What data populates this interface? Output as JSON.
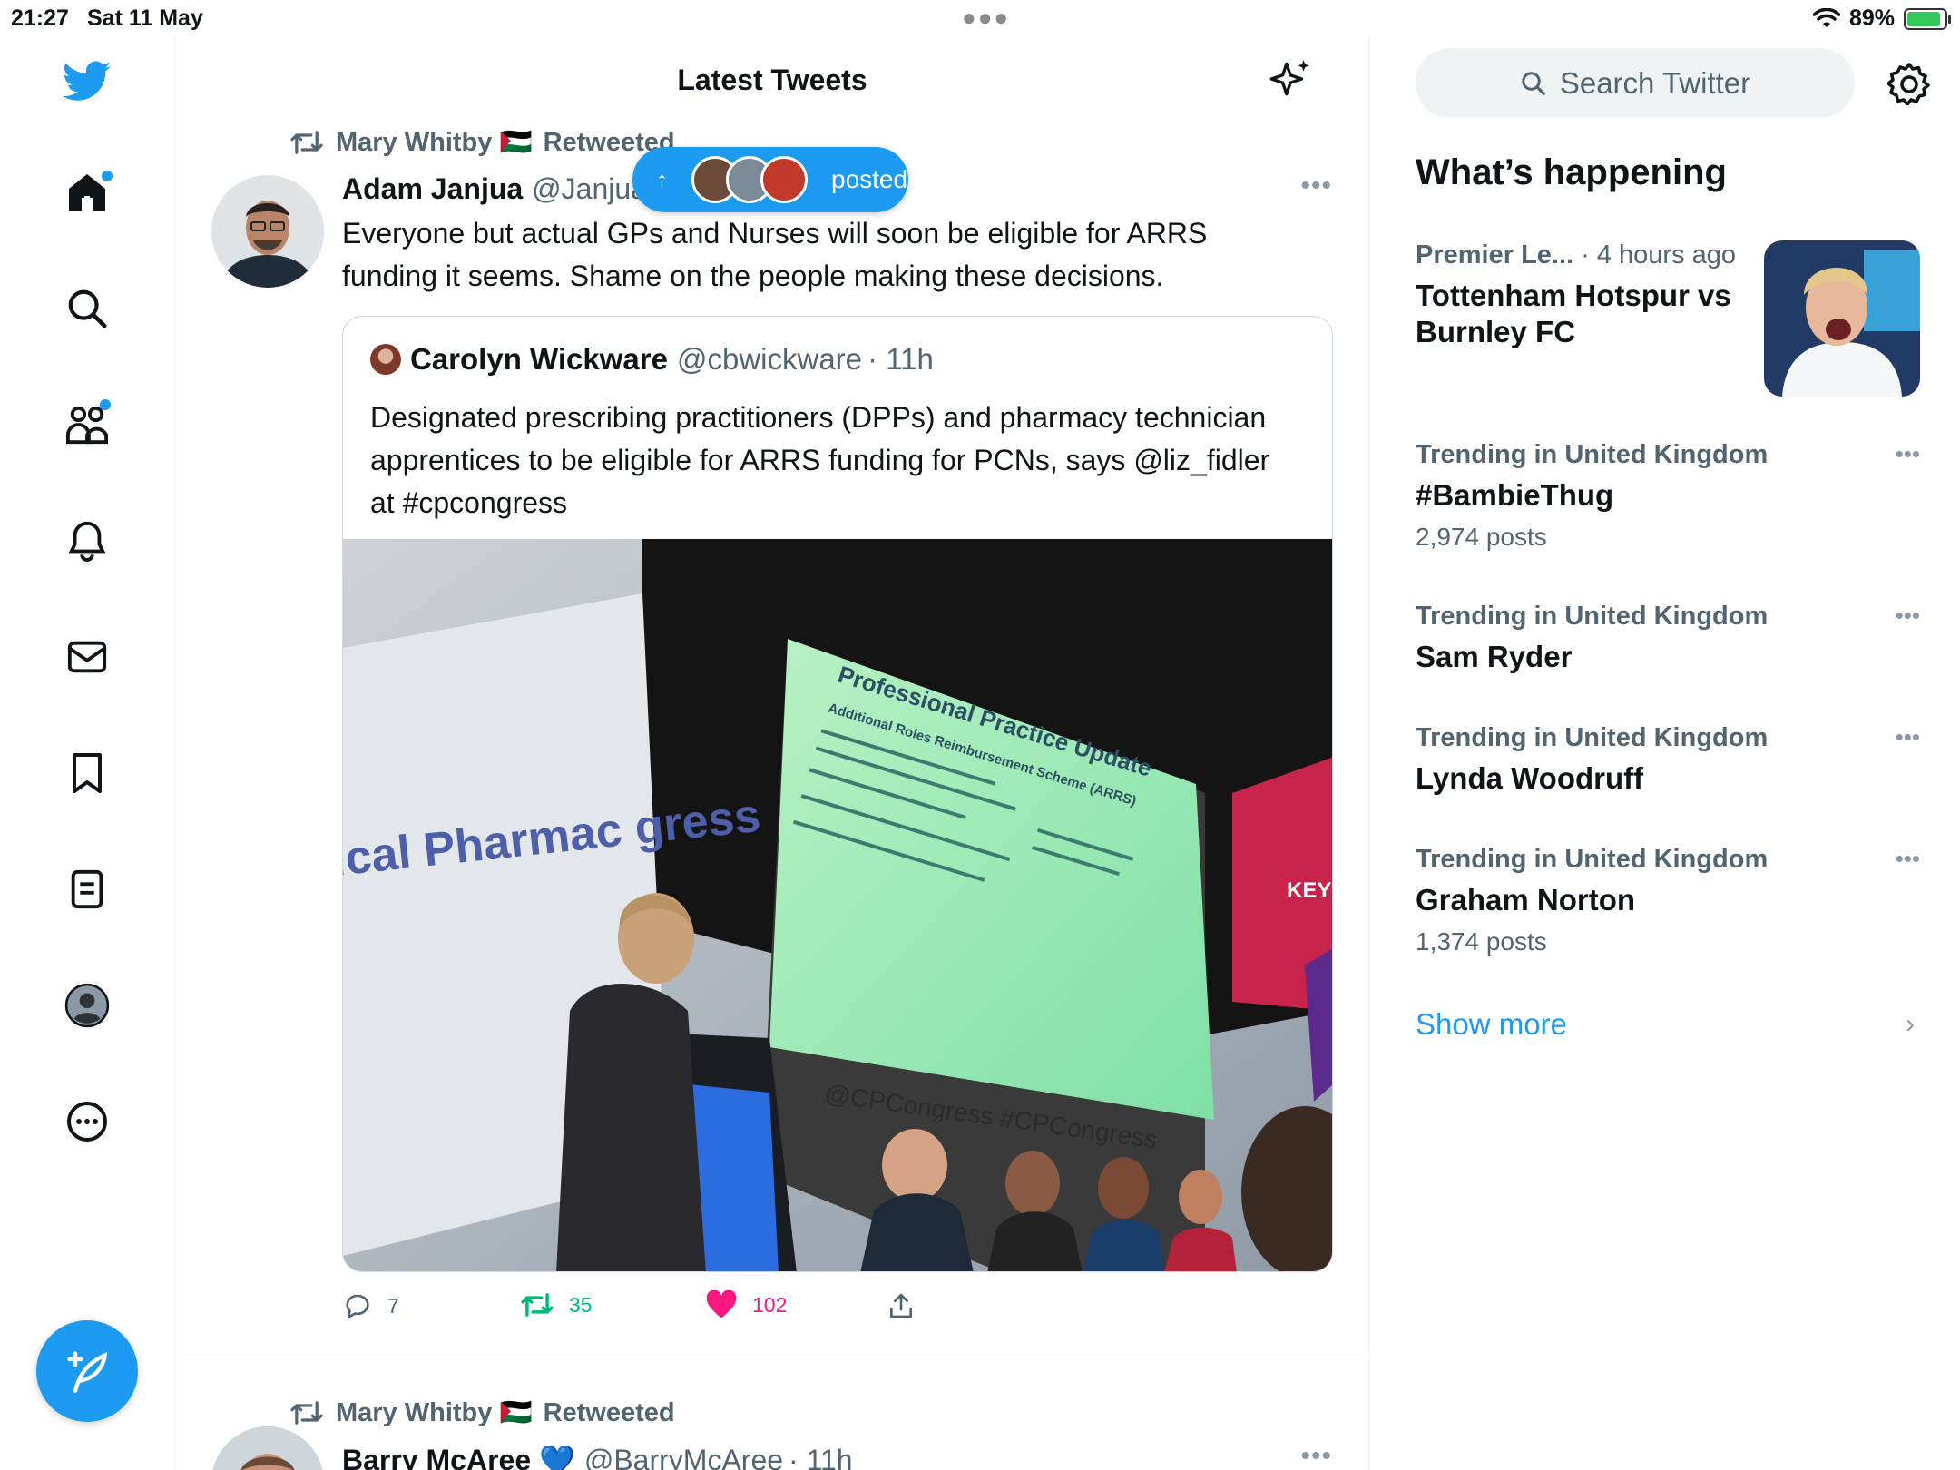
{
  "status_bar": {
    "time": "21:27",
    "date": "Sat 11 May",
    "battery": "89%",
    "battery_level": 0.89
  },
  "nav": {
    "items": [
      "home-icon",
      "search-icon",
      "communities-icon",
      "notifications-icon",
      "messages-icon",
      "bookmarks-icon",
      "lists-icon",
      "profile-icon",
      "more-icon"
    ],
    "compose_icon": "compose-icon",
    "accent": "#1d9bf0"
  },
  "timeline": {
    "title": "Latest Tweets",
    "new_posts_pill": "posted",
    "tweets": [
      {
        "retweeted_by": "Mary Whitby 🇵🇸",
        "retweeted_label": "Retweeted",
        "name": "Adam Janjua",
        "handle": "@Janjua",
        "text": "Everyone but actual GPs and Nurses will soon be eligible for ARRS funding it seems. Shame on the people making these decisions.",
        "quote": {
          "name": "Carolyn Wickware",
          "handle": "@cbwickware",
          "time": "· 11h",
          "text": "Designated prescribing practitioners (DPPs) and pharmacy technician apprentices to be eligible for ARRS funding for PCNs, says @liz_fidler at #cpcongress",
          "image": {
            "banner_text": "ical Pharmac gress",
            "slide_title": "Professional Practice Update",
            "slide_subtitle": "Additional Roles Reimbursement Scheme (ARRS)",
            "hashtag_banner": "@CPCongress #CPCongress",
            "side_text": "KEY"
          }
        },
        "replies": "7",
        "retweets": "35",
        "likes": "102"
      },
      {
        "retweeted_by": "Mary Whitby 🇵🇸",
        "retweeted_label": "Retweeted",
        "name": "Barry McAree 💙",
        "handle": "@BarryMcAree",
        "time": "· 11h"
      }
    ]
  },
  "sidebar": {
    "search_placeholder": "Search Twitter",
    "whats_happening": "What’s happening",
    "trends": [
      {
        "meta_bold": "Premier Le...",
        "meta_rest": " · 4 hours ago",
        "title": "Tottenham Hotspur vs Burnley FC",
        "count": ""
      },
      {
        "meta_bold": "Trending in United Kingdom",
        "meta_rest": "",
        "title": "#BambieThug",
        "count": "2,974 posts"
      },
      {
        "meta_bold": "Trending in United Kingdom",
        "meta_rest": "",
        "title": "Sam Ryder",
        "count": ""
      },
      {
        "meta_bold": "Trending in United Kingdom",
        "meta_rest": "",
        "title": "Lynda Woodruff",
        "count": ""
      },
      {
        "meta_bold": "Trending in United Kingdom",
        "meta_rest": "",
        "title": "Graham Norton",
        "count": "1,374 posts"
      }
    ],
    "show_more": "Show more"
  }
}
